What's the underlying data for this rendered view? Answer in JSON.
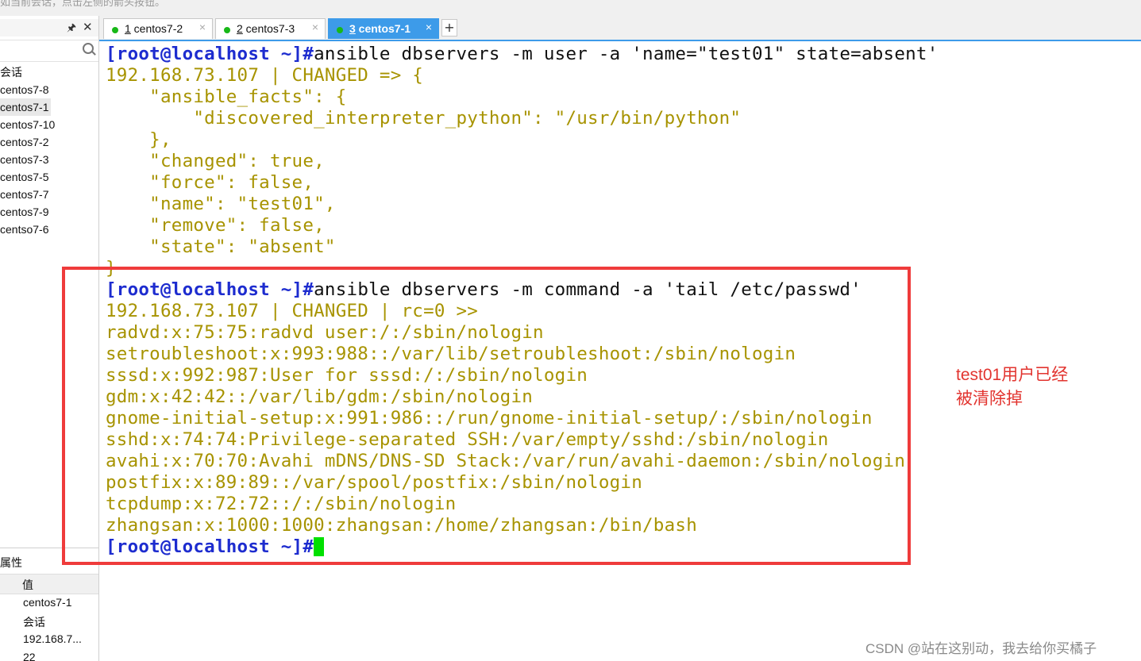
{
  "top_hint": "如当前会话，点击左侧的箭头按钮。",
  "sessions_panel": {
    "pin_icon": "pin-icon",
    "close_icon": "close-icon",
    "search_icon": "search-icon",
    "items": [
      "会话",
      "centos7-8",
      "centos7-1",
      "centos7-10",
      "centos7-2",
      "centos7-3",
      "centos7-5",
      "centos7-7",
      "centos7-9",
      "centso7-6"
    ],
    "selected": "centos7-1"
  },
  "properties_panel": {
    "title": "属性",
    "value_header": "值",
    "rows": [
      "centos7-1",
      "会话",
      "192.168.7...",
      "22"
    ]
  },
  "tabs": [
    {
      "num": "1",
      "label": " centos7-2",
      "status_color": "#18b818"
    },
    {
      "num": "2",
      "label": " centos7-3",
      "status_color": "#18b818"
    },
    {
      "num": "3",
      "label": " centos7-1",
      "status_color": "#18b818"
    }
  ],
  "tab_close": "×",
  "add_tab": "+",
  "terminal": {
    "prompt": "[root@localhost ~]#",
    "cmd1": "ansible dbservers -m user -a 'name=\"test01\" state=absent'",
    "out1": [
      "192.168.73.107 | CHANGED => {",
      "    \"ansible_facts\": {",
      "        \"discovered_interpreter_python\": \"/usr/bin/python\"",
      "    },",
      "    \"changed\": true,",
      "    \"force\": false,",
      "    \"name\": \"test01\",",
      "    \"remove\": false,",
      "    \"state\": \"absent\"",
      "}"
    ],
    "cmd2": "ansible dbservers -m command -a 'tail /etc/passwd'",
    "out2": [
      "192.168.73.107 | CHANGED | rc=0 >>",
      "radvd:x:75:75:radvd user:/:/sbin/nologin",
      "setroubleshoot:x:993:988::/var/lib/setroubleshoot:/sbin/nologin",
      "sssd:x:992:987:User for sssd:/:/sbin/nologin",
      "gdm:x:42:42::/var/lib/gdm:/sbin/nologin",
      "gnome-initial-setup:x:991:986::/run/gnome-initial-setup/:/sbin/nologin",
      "sshd:x:74:74:Privilege-separated SSH:/var/empty/sshd:/sbin/nologin",
      "avahi:x:70:70:Avahi mDNS/DNS-SD Stack:/var/run/avahi-daemon:/sbin/nologin",
      "postfix:x:89:89::/var/spool/postfix:/sbin/nologin",
      "tcpdump:x:72:72::/:/sbin/nologin",
      "zhangsan:x:1000:1000:zhangsan:/home/zhangsan:/bin/bash"
    ]
  },
  "annotation": {
    "line1": "test01用户已经",
    "line2": "被清除掉"
  },
  "watermark": "CSDN @站在这别动，我去给你买橘子",
  "colors": {
    "prompt": "#1d2ccf",
    "output": "#a79300",
    "highlight_box": "#ef3b3b",
    "active_tab": "#3d9be9",
    "cursor": "#00e000"
  }
}
